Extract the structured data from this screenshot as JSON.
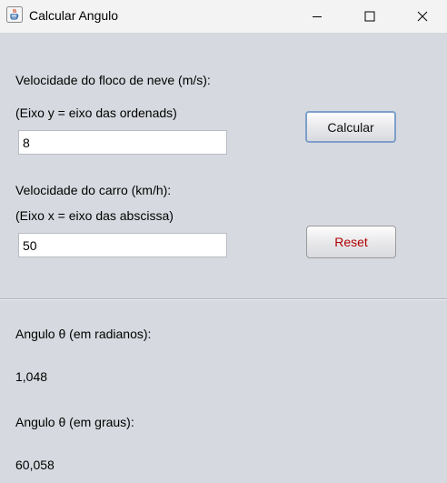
{
  "window": {
    "title": "Calcular Angulo"
  },
  "form": {
    "snowflake_label": "Velocidade do floco de neve (m/s):",
    "snowflake_axis_label": "(Eixo y = eixo das ordenads)",
    "snowflake_value": "8",
    "car_label": "Velocidade do carro (km/h):",
    "car_axis_label": "(Eixo x = eixo das abscissa)",
    "car_value": "50"
  },
  "buttons": {
    "calculate_label": "Calcular",
    "reset_label": "Reset"
  },
  "results": {
    "radians_label": "Angulo θ (em radianos):",
    "radians_value": "1,048",
    "degrees_label": "Angulo θ (em graus):",
    "degrees_value": "60,058"
  },
  "colors": {
    "reset_text": "#b00000",
    "calculate_border": "#7f9fca",
    "background": "#d6d9df"
  },
  "icons": {
    "app": "java-app-icon",
    "minimize": "minimize-icon",
    "maximize": "maximize-icon",
    "close": "close-icon"
  }
}
